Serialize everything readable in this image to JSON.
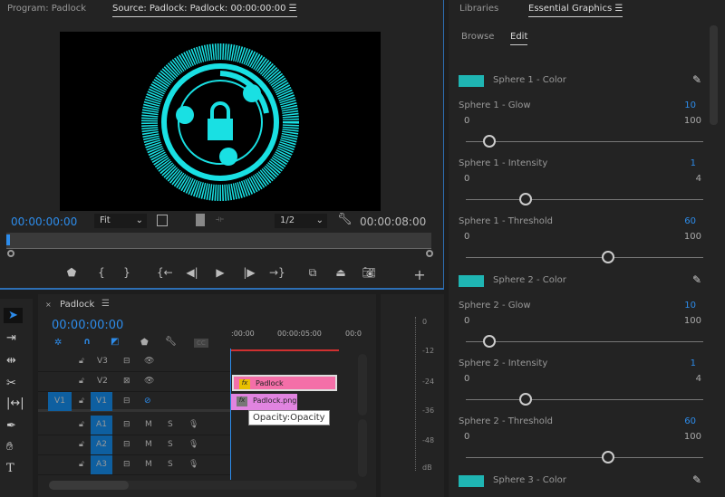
{
  "program": {
    "tab_program": "Program: Padlock",
    "tab_source": "Source: Padlock: Padlock: 00:00:00:00",
    "timecode": "00:00:00:00",
    "zoom": "Fit",
    "resolution": "1/2",
    "duration": "00:00:08:00"
  },
  "timeline": {
    "title": "Padlock",
    "timecode": "00:00:00:00",
    "ruler": [
      ":00:00",
      "00:00:05:00",
      "00:0"
    ],
    "video_tracks": [
      {
        "name": "V3",
        "source": ""
      },
      {
        "name": "V2",
        "source": ""
      },
      {
        "name": "V1",
        "source": "V1"
      }
    ],
    "audio_tracks": [
      {
        "name": "A1",
        "m": "M",
        "s": "S"
      },
      {
        "name": "A2",
        "m": "M",
        "s": "S"
      },
      {
        "name": "A3",
        "m": "M",
        "s": "S"
      }
    ],
    "clips": [
      {
        "label": "Padlock",
        "fx": "fx",
        "color": "#f46fa8"
      },
      {
        "label": "Padlock.png",
        "fx": "fx",
        "color": "#e184e0"
      }
    ],
    "tooltip": "Opacity:Opacity",
    "cc": "CC"
  },
  "meter": {
    "ticks": [
      "0",
      "-12",
      "-24",
      "-36",
      "-48",
      "dB"
    ]
  },
  "essential_graphics": {
    "tab_libraries": "Libraries",
    "tab_eg": "Essential Graphics",
    "tab_browse": "Browse",
    "tab_edit": "Edit",
    "items": [
      {
        "type": "color",
        "label": "Sphere 1 - Color",
        "color": "#1fb5b3"
      },
      {
        "type": "slider",
        "label": "Sphere 1 - Glow",
        "value": "10",
        "min": "0",
        "max": "100",
        "fraction": 0.1
      },
      {
        "type": "slider",
        "label": "Sphere 1 - Intensity",
        "value": "1",
        "min": "0",
        "max": "4",
        "fraction": 0.25
      },
      {
        "type": "slider",
        "label": "Sphere 1 - Threshold",
        "value": "60",
        "min": "0",
        "max": "100",
        "fraction": 0.6
      },
      {
        "type": "color",
        "label": "Sphere 2 - Color",
        "color": "#1fb5b3"
      },
      {
        "type": "slider",
        "label": "Sphere 2 - Glow",
        "value": "10",
        "min": "0",
        "max": "100",
        "fraction": 0.1
      },
      {
        "type": "slider",
        "label": "Sphere 2 -  Intensity",
        "value": "1",
        "min": "0",
        "max": "4",
        "fraction": 0.25
      },
      {
        "type": "slider",
        "label": "Sphere 2 - Threshold",
        "value": "60",
        "min": "0",
        "max": "100",
        "fraction": 0.6
      },
      {
        "type": "color",
        "label": "Sphere 3  - Color",
        "color": "#1fb5b3"
      }
    ]
  }
}
